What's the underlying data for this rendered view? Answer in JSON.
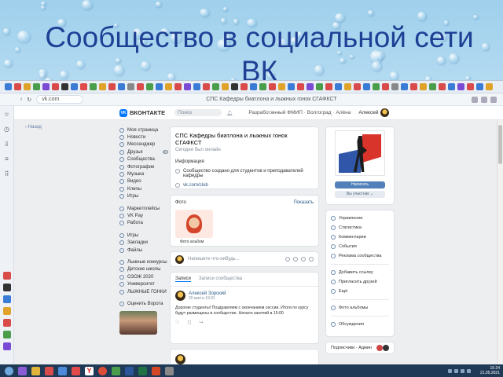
{
  "slide": {
    "title": "Сообщество в социальной сети ВК"
  },
  "browser": {
    "url": "vk.com",
    "page_title": "СПС Кафедры биатлона и лыжных гонок СГАФКСТ"
  },
  "vk_header": {
    "logo": "ВКОНТАКТЕ",
    "search_placeholder": "Поиск",
    "center_text": "Разработанный ФМИП · Волгоград · Алёна",
    "user_name": "Алексей"
  },
  "back_link": "‹ Назад",
  "leftnav": {
    "items": [
      {
        "label": "Моя страница"
      },
      {
        "label": "Новости"
      },
      {
        "label": "Мессенджер"
      },
      {
        "label": "Друзья",
        "badge": "9"
      },
      {
        "label": "Сообщества"
      },
      {
        "label": "Фотографии"
      },
      {
        "label": "Музыка"
      },
      {
        "label": "Видео"
      },
      {
        "label": "Клипы"
      },
      {
        "label": "Игры"
      }
    ],
    "items2": [
      {
        "label": "Маркетплейсы"
      },
      {
        "label": "VK Pay"
      },
      {
        "label": "Работа"
      }
    ],
    "items3": [
      {
        "label": "Игры"
      },
      {
        "label": "Закладки"
      },
      {
        "label": "Файлы"
      }
    ],
    "items4": [
      {
        "label": "Лыжные конкурсы"
      },
      {
        "label": "Детские школы"
      },
      {
        "label": "ОЗОЖ 2020"
      },
      {
        "label": "Университет"
      },
      {
        "label": "ЛЫЖНЫЕ ГОНКИ"
      }
    ],
    "footer": "Оценить Ворота"
  },
  "info": {
    "group_title": "СПС Кафедры биатлона и лыжных гонок СГАФКСТ",
    "status": "Сегодня был онлайн",
    "section_label": "Информация",
    "description": "Сообщество создано для студентов и преподавателей кафедры",
    "site": "vk.com/club"
  },
  "photos": {
    "label": "Фото",
    "all_link": "Показать",
    "album_label": "Фото альбом"
  },
  "compose": {
    "placeholder": "Напишите что-нибудь..."
  },
  "feed": {
    "tab_active": "Записи",
    "tab_other": "Записи сообщества",
    "post": {
      "author": "Алексей Зорский",
      "date": "20 мая в 19:01",
      "text": "Дорогие студенты! Поздравляем с окончанием сессии. Итоги по курсу будут размещены в сообществе. Начало занятий в 15:00",
      "like": "♡",
      "comment": "◻",
      "share": "↪"
    }
  },
  "cover": {
    "primary_button": "Написать",
    "secondary_button": "Вы участник ⌄"
  },
  "right_menu": {
    "items": [
      {
        "label": "Управление"
      },
      {
        "label": "Статистика"
      },
      {
        "label": "Комментарии"
      },
      {
        "label": "События"
      },
      {
        "label": "Реклама сообщества"
      }
    ],
    "items2": [
      {
        "label": "Добавить ссылку"
      },
      {
        "label": "Пригласить друзей"
      },
      {
        "label": "Ещё"
      }
    ],
    "items3": [
      {
        "label": "Фото альбомы"
      }
    ],
    "items4": [
      {
        "label": "Обсуждения"
      }
    ]
  },
  "admins": {
    "label": "Подписчики · Админ"
  },
  "taskbar": {
    "time": "15:24",
    "date": "21.05.2021"
  },
  "colors": {
    "accent": "#0077ff",
    "link": "#2a5885",
    "title": "#1f3f95",
    "taskbar": "#1f3a56"
  }
}
